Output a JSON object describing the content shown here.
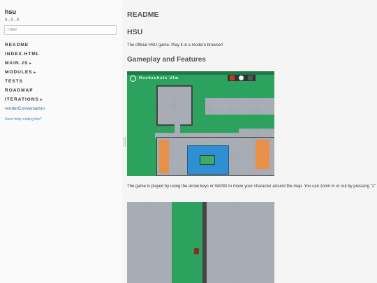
{
  "sidebar": {
    "app_name": "hsu",
    "version": "0.0.0",
    "filter_placeholder": "Filter",
    "nav": [
      {
        "label": "README",
        "has_arrow": false
      },
      {
        "label": "INDEX.HTML",
        "has_arrow": false
      },
      {
        "label": "MAIN.JS",
        "has_arrow": true
      },
      {
        "label": "MODULES",
        "has_arrow": true
      },
      {
        "label": "TESTS",
        "has_arrow": false
      },
      {
        "label": "ROADMAP",
        "has_arrow": false
      },
      {
        "label": "ITERATIONS",
        "has_arrow": true
      }
    ],
    "link": "renderConversation",
    "help": "Need help reading this?"
  },
  "main": {
    "heading": "README",
    "title": "HSU",
    "intro": "The official HSU game. Play it in a modern browser!",
    "gameplay_heading": "Gameplay and Features",
    "screenshot_banner": "Hochschule Ulm",
    "description": "The game is played by using the arrow keys or WASD to move your character around the map. You can zoom in or out by pressing \"z\""
  },
  "colors": {
    "accent_link": "#2f6fb0",
    "grass": "#2da15e",
    "water": "#2f8fd0",
    "sand": "#e89048"
  },
  "icons": {
    "nav_arrow": "▸"
  }
}
